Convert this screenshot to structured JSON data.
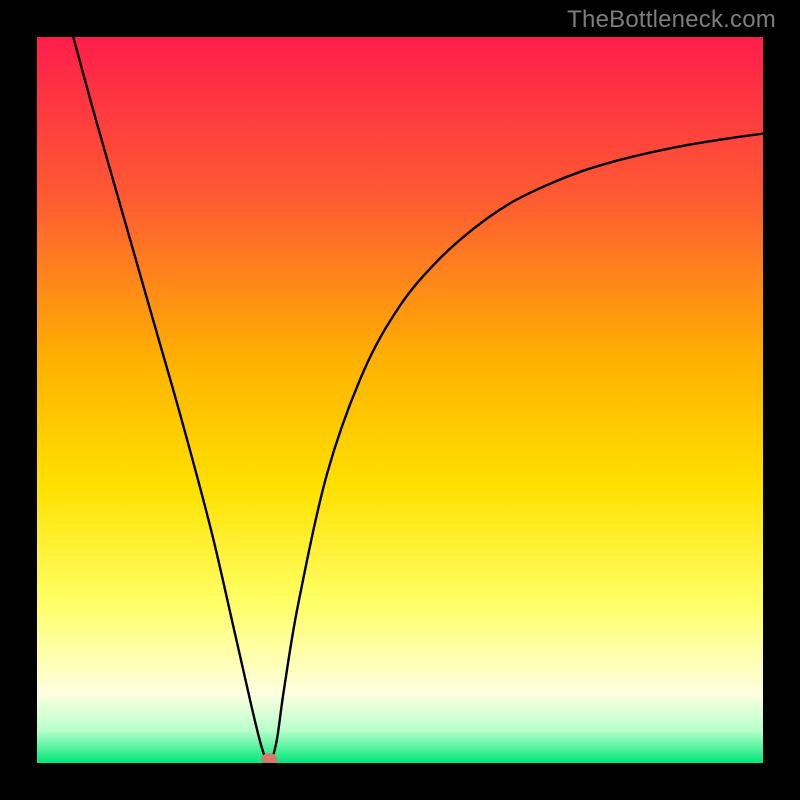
{
  "attribution": "TheBottleneck.com",
  "colors": {
    "frame": "#000000",
    "gradient_top": "#ff1e4a",
    "gradient_mid_upper": "#ff7a25",
    "gradient_mid": "#ffd400",
    "gradient_lower": "#ffff66",
    "gradient_pale": "#fdffe0",
    "gradient_bottom": "#00e878",
    "curve": "#000000",
    "marker": "#d67a6d"
  },
  "chart_data": {
    "type": "line",
    "title": "",
    "xlabel": "",
    "ylabel": "",
    "xlim": [
      0,
      100
    ],
    "ylim": [
      0,
      100
    ],
    "series": [
      {
        "name": "bottleneck-curve",
        "x": [
          5,
          8,
          12,
          16,
          20,
          24,
          27,
          29.5,
          31,
          32,
          33,
          34,
          36,
          40,
          45,
          50,
          55,
          60,
          65,
          70,
          75,
          80,
          85,
          90,
          95,
          100
        ],
        "y": [
          100,
          89,
          75,
          61,
          47,
          32,
          19,
          8,
          2,
          0,
          3,
          10,
          22,
          40,
          54,
          63,
          69,
          73.5,
          77,
          79.5,
          81.5,
          83,
          84.2,
          85.2,
          86,
          86.7
        ]
      }
    ],
    "marker": {
      "x": 32,
      "y": 0,
      "name": "optimal-point"
    },
    "gradient_stops": [
      {
        "offset": 0.0,
        "color": "#ff1e4a"
      },
      {
        "offset": 0.22,
        "color": "#ff5a33"
      },
      {
        "offset": 0.45,
        "color": "#ffb300"
      },
      {
        "offset": 0.62,
        "color": "#ffe100"
      },
      {
        "offset": 0.78,
        "color": "#ffff66"
      },
      {
        "offset": 0.905,
        "color": "#fdffe0"
      },
      {
        "offset": 0.955,
        "color": "#b8ffcc"
      },
      {
        "offset": 1.0,
        "color": "#00e878"
      }
    ]
  }
}
